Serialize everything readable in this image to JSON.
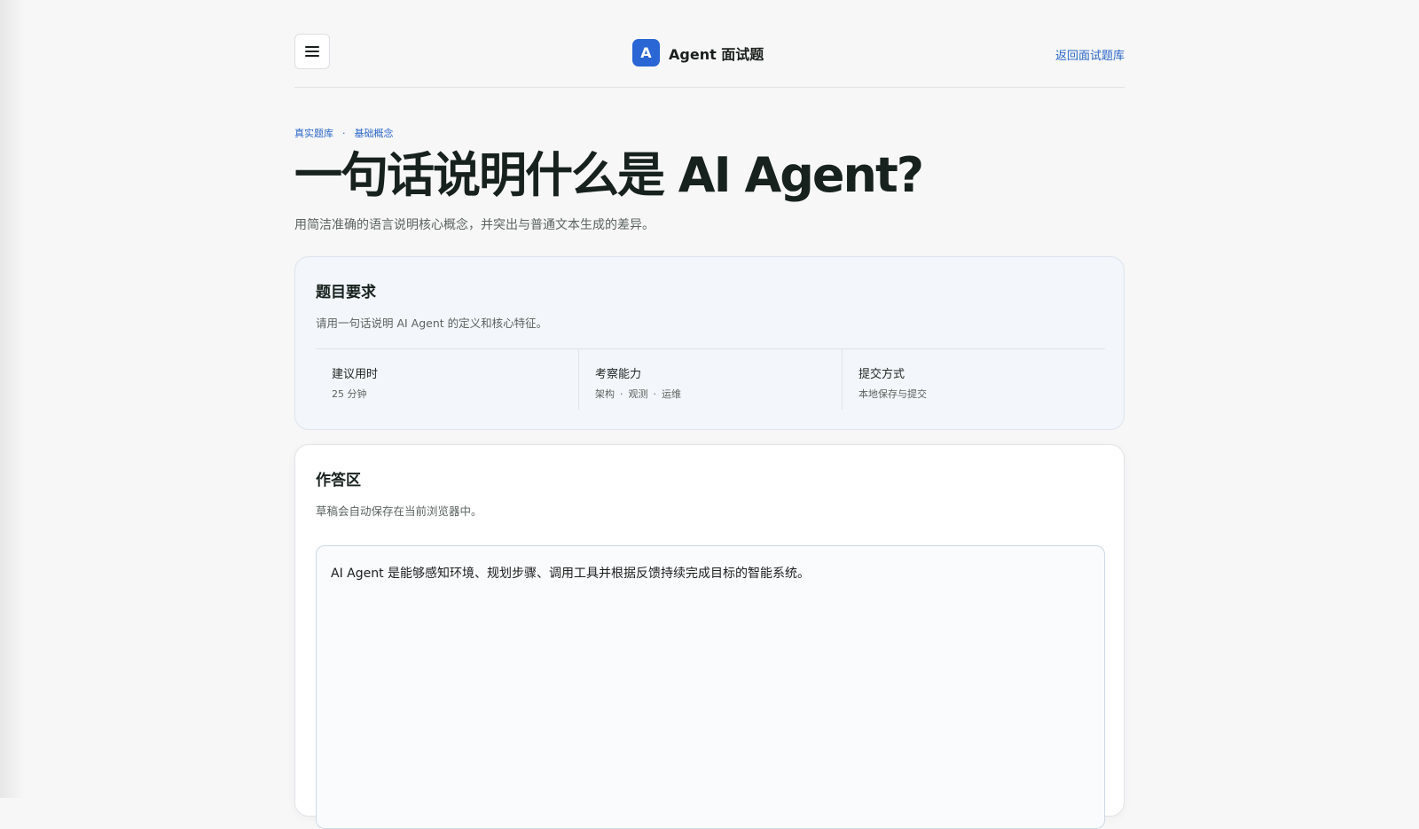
{
  "header": {
    "brand_letter": "A",
    "brand_name": "Agent 面试题",
    "back_link": "返回面试题库",
    "menu_icon": "hamburger-menu-icon"
  },
  "breadcrumb": {
    "items": [
      "真实题库",
      "基础概念"
    ],
    "separator": "·"
  },
  "question": {
    "title": "一句话说明什么是 AI Agent?",
    "subtitle": "用简洁准确的语言说明核心概念，并突出与普通文本生成的差异。"
  },
  "requirements": {
    "title": "题目要求",
    "description": "请用一句话说明 AI Agent 的定义和核心特征。",
    "meta": [
      {
        "label": "建议用时",
        "value": "25 分钟"
      },
      {
        "label": "考察能力",
        "tags": [
          "架构",
          "观测",
          "运维"
        ]
      },
      {
        "label": "提交方式",
        "value": "本地保存与提交"
      }
    ]
  },
  "answer": {
    "title": "作答区",
    "description": "草稿会自动保存在当前浏览器中。",
    "value": "AI Agent 是能够感知环境、规划步骤、调用工具并根据反馈持续完成目标的智能系统。"
  },
  "colors": {
    "accent": "#2a66d4",
    "link": "#2a66c8",
    "background": "#f7f7f7",
    "card_muted": "#f3f6fa"
  }
}
